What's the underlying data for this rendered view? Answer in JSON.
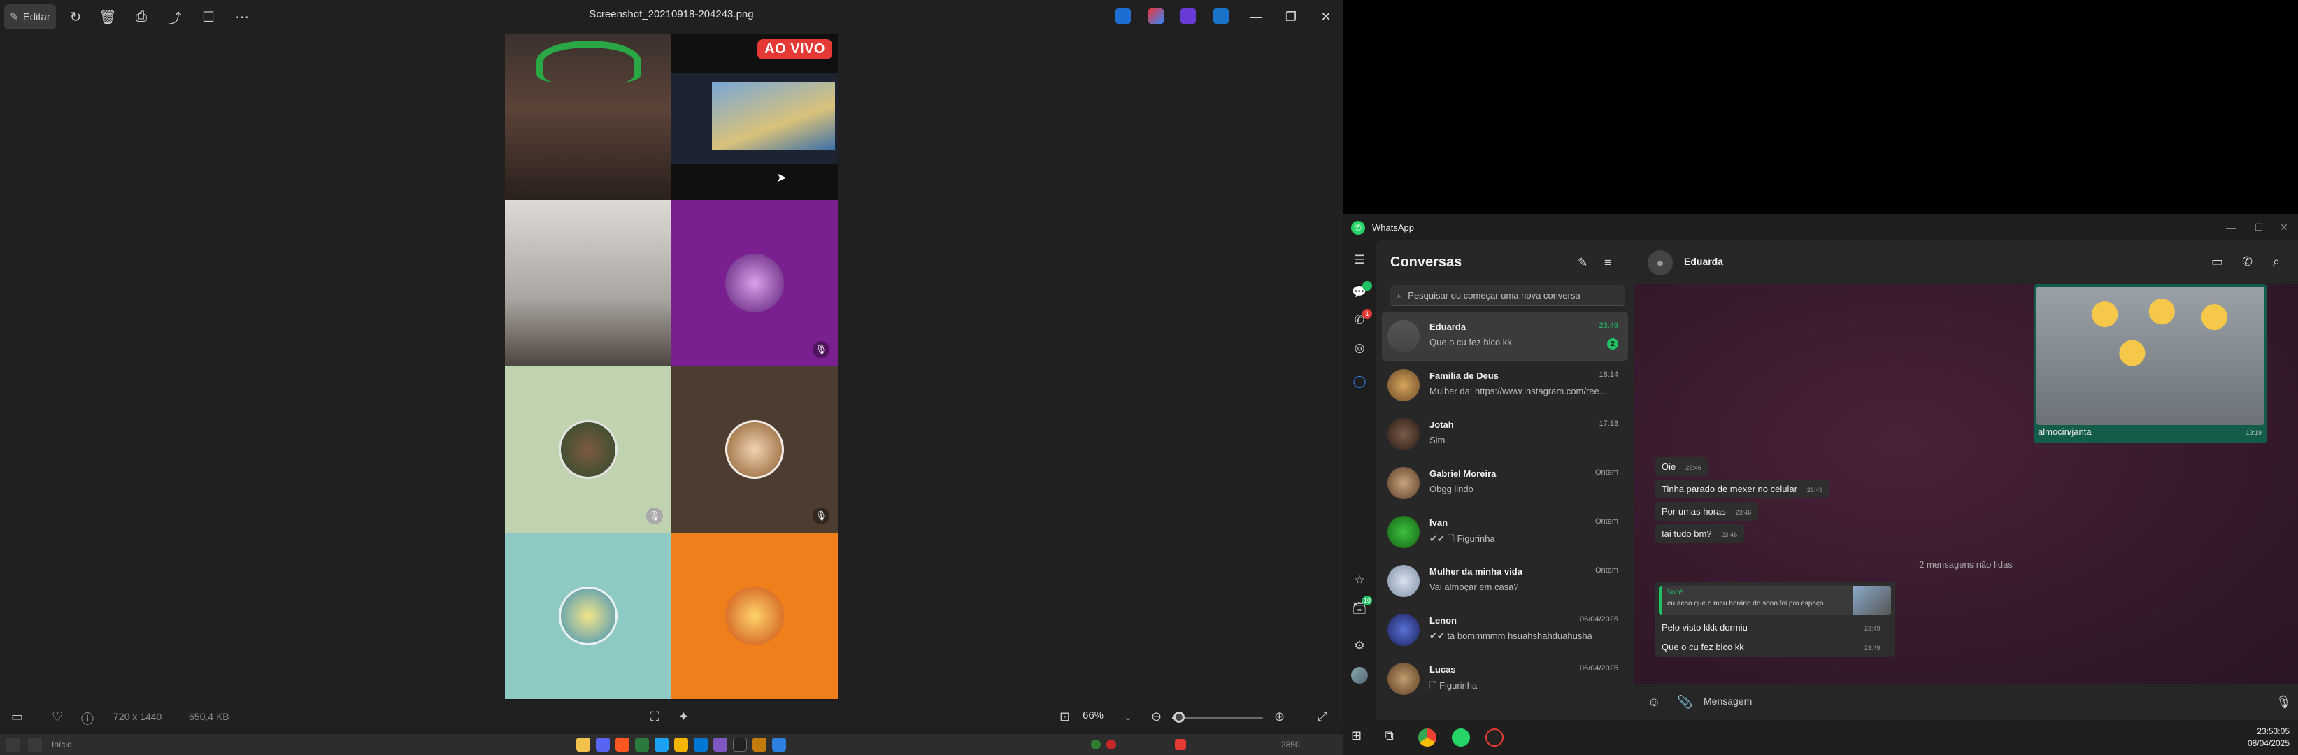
{
  "photos": {
    "edit_label": "Editar",
    "title": "Screenshot_20210918-204243.png",
    "live_badge": "AO VIVO",
    "dimensions": "720 x 1440",
    "filesize": "650,4 KB",
    "zoom": "66%",
    "zoom_fraction": 0.08,
    "toolbar_icons": [
      "rotate-icon",
      "delete-icon",
      "print-icon",
      "share-icon",
      "info-icon",
      "more-icon"
    ]
  },
  "taskbar_left": {
    "search_hint": "Início",
    "tray_text": "2850"
  },
  "whatsapp": {
    "app_name": "WhatsApp",
    "list_title": "Conversas",
    "search_placeholder": "Pesquisar ou começar uma nova conversa",
    "rail_badges": {
      "calls": "1",
      "status": "10"
    },
    "chats": [
      {
        "name": "Eduarda",
        "preview": "Que o cu fez bico kk",
        "time": "23:49",
        "unread": "2",
        "active": true
      },
      {
        "name": "Familia de Deus",
        "preview": "Mulher da: https://www.instagram.com/ree...",
        "time": "18:14"
      },
      {
        "name": "Jotah",
        "preview": "Sim",
        "time": "17:18"
      },
      {
        "name": "Gabriel Moreira",
        "preview": "Obgg lindo",
        "time": "Ontem"
      },
      {
        "name": "Ivan",
        "preview": "✔✔ 🗋 Figurinha",
        "time": "Ontem"
      },
      {
        "name": "Mulher da minha vida",
        "preview": "Vai almoçar em casa?",
        "time": "Ontem"
      },
      {
        "name": "Lenon",
        "preview": "✔✔ tá bommmmm hsuahshahduahusha",
        "time": "06/04/2025"
      },
      {
        "name": "Lucas",
        "preview": "🗋 Figurinha",
        "time": "06/04/2025"
      }
    ],
    "conversation": {
      "contact": "Eduarda",
      "image_caption": "almocin/janta",
      "image_time": "19:19",
      "messages": [
        {
          "text": "Oie",
          "time": "23:46"
        },
        {
          "text": "Tinha parado de mexer no celular",
          "time": "23:46"
        },
        {
          "text": "Por umas horas",
          "time": "23:46"
        },
        {
          "text": "Iai tudo bm?",
          "time": "23:46"
        }
      ],
      "unread_separator": "2 mensagens não lidas",
      "quote_author": "Você",
      "quote_text": "eu acho que o meu horário de sono foi pro espaço",
      "reply_messages": [
        {
          "text": "Pelo visto kkk dormiu",
          "time": "23:49"
        },
        {
          "text": "Que o cu fez bico kk",
          "time": "23:49"
        }
      ],
      "input_placeholder": "Mensagem"
    }
  },
  "clock": {
    "time": "23:53:05",
    "date": "08/04/2025"
  },
  "colors": {
    "accent": "#21c063",
    "live": "#e53935",
    "purple_tile": "#7a1f8f",
    "orange_tile": "#ef7f1a"
  }
}
